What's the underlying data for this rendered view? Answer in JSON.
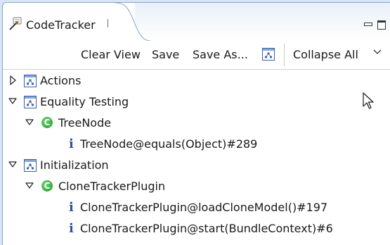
{
  "tab": {
    "title": "CodeTracker",
    "close_glyph": "⌧"
  },
  "toolbar": {
    "clear_view": "Clear View",
    "save": "Save",
    "save_as": "Save As...",
    "collapse_all": "Collapse All"
  },
  "tree": [
    {
      "label": "Actions",
      "kind": "category",
      "level": 0,
      "expanded": false
    },
    {
      "label": "Equality Testing",
      "kind": "category",
      "level": 0,
      "expanded": true
    },
    {
      "label": "TreeNode",
      "kind": "class",
      "level": 1,
      "expanded": true
    },
    {
      "label": "TreeNode@equals(Object)#289",
      "kind": "info",
      "level": 2
    },
    {
      "label": "Initialization",
      "kind": "category",
      "level": 0,
      "expanded": true
    },
    {
      "label": "CloneTrackerPlugin",
      "kind": "class",
      "level": 1,
      "expanded": true
    },
    {
      "label": "CloneTrackerPlugin@loadCloneModel()#197",
      "kind": "info",
      "level": 2
    },
    {
      "label": "CloneTrackerPlugin@start(BundleContext)#6",
      "kind": "info",
      "level": 2
    }
  ],
  "icons": {
    "class_glyph": "C",
    "info_glyph": "i"
  },
  "colors": {
    "background": "#d6e6f7",
    "class_icon": "#1e9a2e",
    "info_icon": "#2d4fa8"
  }
}
